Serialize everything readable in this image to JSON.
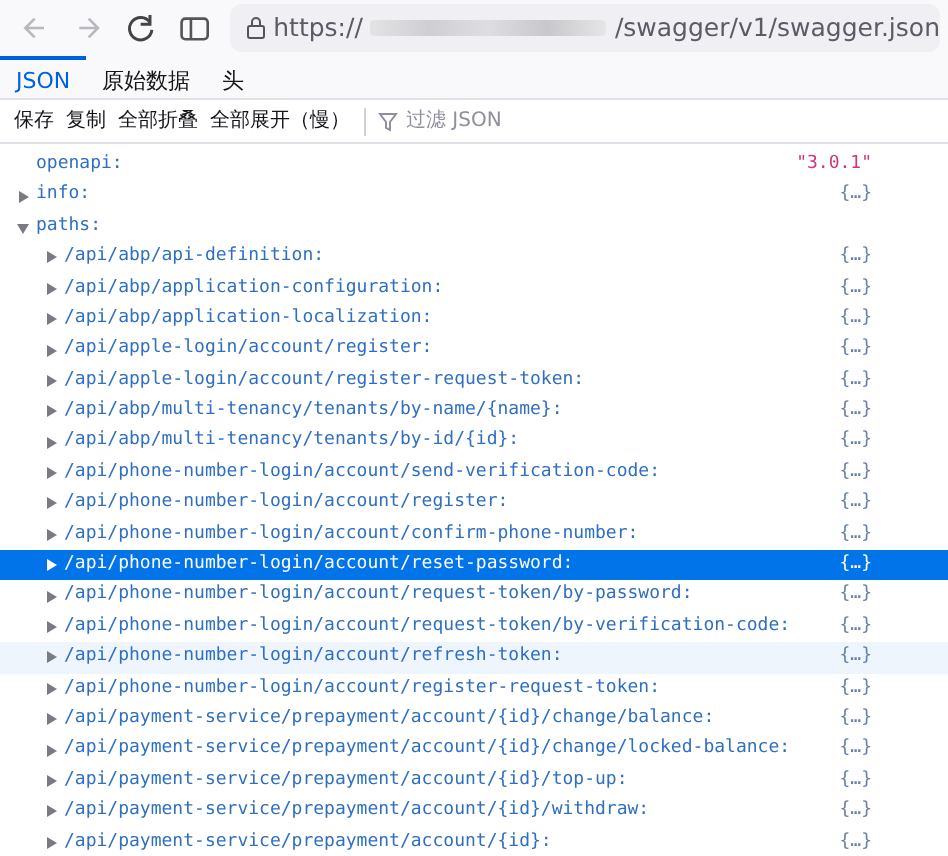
{
  "browser": {
    "url_scheme": "https://",
    "url_path": "/swagger/v1/swagger.json"
  },
  "tabs": [
    {
      "label": "JSON",
      "selected": true
    },
    {
      "label": "原始数据",
      "selected": false
    },
    {
      "label": "头",
      "selected": false
    }
  ],
  "toolbar": {
    "buttons": [
      "保存",
      "复制",
      "全部折叠",
      "全部展开（慢）"
    ],
    "filter_placeholder": "过滤 JSON"
  },
  "tree": [
    {
      "key": "openapi:",
      "value": "\"3.0.1\"",
      "kind": "string",
      "selected": false,
      "hovered": false
    },
    {
      "key": "info:",
      "value": "{…}",
      "kind": "object",
      "expanded": false,
      "selected": false,
      "hovered": false
    },
    {
      "key": "paths:",
      "kind": "object",
      "expanded": true,
      "selected": false,
      "hovered": false,
      "children": [
        {
          "key": "/api/abp/api-definition:",
          "value": "{…}",
          "kind": "object",
          "expanded": false,
          "selected": false,
          "hovered": false
        },
        {
          "key": "/api/abp/application-configuration:",
          "value": "{…}",
          "kind": "object",
          "expanded": false,
          "selected": false,
          "hovered": false
        },
        {
          "key": "/api/abp/application-localization:",
          "value": "{…}",
          "kind": "object",
          "expanded": false,
          "selected": false,
          "hovered": false
        },
        {
          "key": "/api/apple-login/account/register:",
          "value": "{…}",
          "kind": "object",
          "expanded": false,
          "selected": false,
          "hovered": false
        },
        {
          "key": "/api/apple-login/account/register-request-token:",
          "value": "{…}",
          "kind": "object",
          "expanded": false,
          "selected": false,
          "hovered": false
        },
        {
          "key": "/api/abp/multi-tenancy/tenants/by-name/{name}:",
          "value": "{…}",
          "kind": "object",
          "expanded": false,
          "selected": false,
          "hovered": false
        },
        {
          "key": "/api/abp/multi-tenancy/tenants/by-id/{id}:",
          "value": "{…}",
          "kind": "object",
          "expanded": false,
          "selected": false,
          "hovered": false
        },
        {
          "key": "/api/phone-number-login/account/send-verification-code:",
          "value": "{…}",
          "kind": "object",
          "expanded": false,
          "selected": false,
          "hovered": false
        },
        {
          "key": "/api/phone-number-login/account/register:",
          "value": "{…}",
          "kind": "object",
          "expanded": false,
          "selected": false,
          "hovered": false
        },
        {
          "key": "/api/phone-number-login/account/confirm-phone-number:",
          "value": "{…}",
          "kind": "object",
          "expanded": false,
          "selected": false,
          "hovered": false
        },
        {
          "key": "/api/phone-number-login/account/reset-password:",
          "value": "{…}",
          "kind": "object",
          "expanded": false,
          "selected": true,
          "hovered": false
        },
        {
          "key": "/api/phone-number-login/account/request-token/by-password:",
          "value": "{…}",
          "kind": "object",
          "expanded": false,
          "selected": false,
          "hovered": false
        },
        {
          "key": "/api/phone-number-login/account/request-token/by-verification-code:",
          "value": "{…}",
          "kind": "object",
          "expanded": false,
          "selected": false,
          "hovered": false
        },
        {
          "key": "/api/phone-number-login/account/refresh-token:",
          "value": "{…}",
          "kind": "object",
          "expanded": false,
          "selected": false,
          "hovered": true
        },
        {
          "key": "/api/phone-number-login/account/register-request-token:",
          "value": "{…}",
          "kind": "object",
          "expanded": false,
          "selected": false,
          "hovered": false
        },
        {
          "key": "/api/payment-service/prepayment/account/{id}/change/balance:",
          "value": "{…}",
          "kind": "object",
          "expanded": false,
          "selected": false,
          "hovered": false
        },
        {
          "key": "/api/payment-service/prepayment/account/{id}/change/locked-balance:",
          "value": "{…}",
          "kind": "object",
          "expanded": false,
          "selected": false,
          "hovered": false
        },
        {
          "key": "/api/payment-service/prepayment/account/{id}/top-up:",
          "value": "{…}",
          "kind": "object",
          "expanded": false,
          "selected": false,
          "hovered": false
        },
        {
          "key": "/api/payment-service/prepayment/account/{id}/withdraw:",
          "value": "{…}",
          "kind": "object",
          "expanded": false,
          "selected": false,
          "hovered": false
        },
        {
          "key": "/api/payment-service/prepayment/account/{id}:",
          "value": "{…}",
          "kind": "object",
          "expanded": false,
          "selected": false,
          "hovered": false
        }
      ]
    }
  ]
}
